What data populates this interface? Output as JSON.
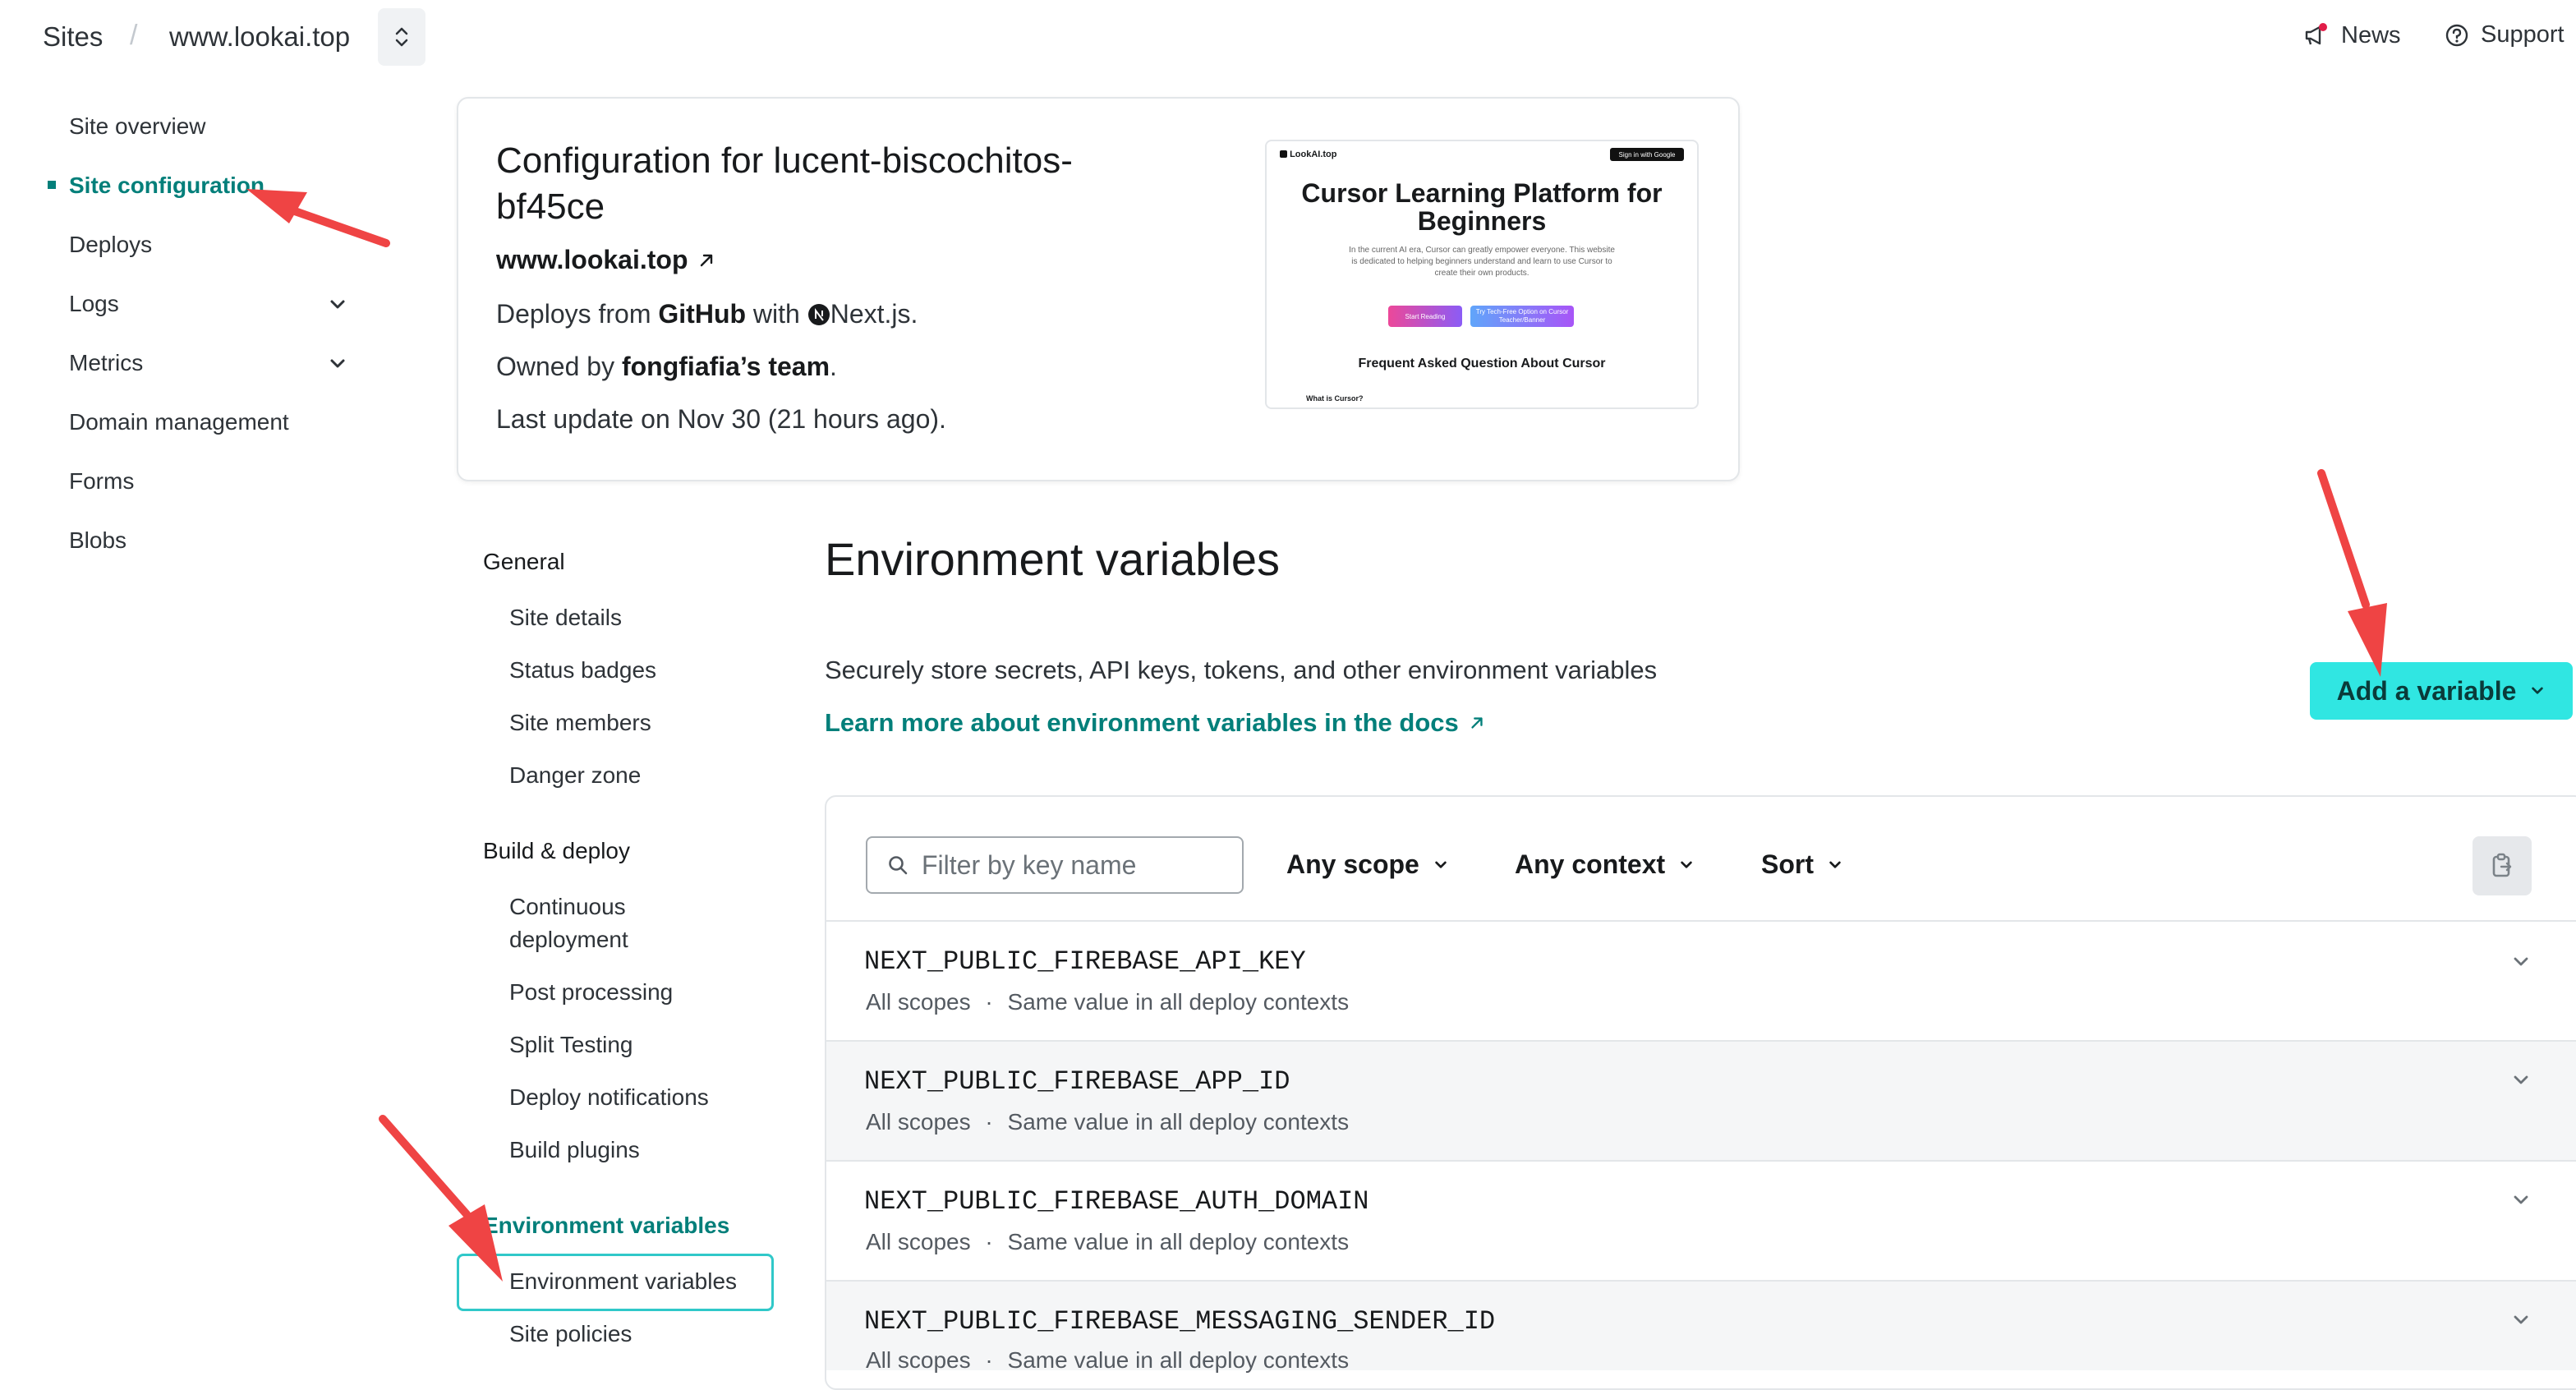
{
  "topbar": {
    "sites_label": "Sites",
    "separator": "/",
    "site_name": "www.lookai.top",
    "news_label": "News",
    "support_label": "Support"
  },
  "sidebar": {
    "items": [
      {
        "label": "Site overview"
      },
      {
        "label": "Site configuration",
        "active": true
      },
      {
        "label": "Deploys"
      },
      {
        "label": "Logs",
        "expandable": true
      },
      {
        "label": "Metrics",
        "expandable": true
      },
      {
        "label": "Domain management"
      },
      {
        "label": "Forms"
      },
      {
        "label": "Blobs"
      }
    ]
  },
  "site_card": {
    "title": "Configuration for lucent-biscochitos-bf45ce",
    "url": "www.lookai.top",
    "deploys_prefix": "Deploys from",
    "deploys_source": "GitHub",
    "deploys_with": "with",
    "framework": "Next.js.",
    "owned_prefix": "Owned by",
    "owner": "fongfiafia’s team",
    "owned_suffix": ".",
    "last_update": "Last update on Nov 30 (21 hours ago).",
    "preview": {
      "logo": "LookAI.top",
      "signin": "Sign in with Google",
      "heading": "Cursor Learning Platform for Beginners",
      "paragraph": "In the current AI era, Cursor can greatly empower everyone. This website is dedicated to helping beginners understand and learn to use Cursor to create their own products.",
      "btn_primary": "Start Reading",
      "btn_secondary": "Try Tech-Free Option on Cursor Teacher/Banner",
      "faq_title": "Frequent Asked Question About Cursor",
      "faq_first": "What is Cursor?"
    }
  },
  "settings_nav": {
    "general": {
      "heading": "General",
      "items": [
        "Site details",
        "Status badges",
        "Site members",
        "Danger zone"
      ]
    },
    "build": {
      "heading": "Build & deploy",
      "items": [
        "Continuous deployment",
        "Post processing",
        "Split Testing",
        "Deploy notifications",
        "Build plugins"
      ]
    },
    "env": {
      "heading": "Environment variables",
      "items": [
        "Environment variables",
        "Site policies"
      ]
    }
  },
  "env": {
    "title": "Environment variables",
    "description": "Securely store secrets, API keys, tokens, and other environment variables",
    "docs_link": "Learn more about environment variables in the docs",
    "add_button": "Add a variable",
    "filter_placeholder": "Filter by key name",
    "scope_dropdown": "Any scope",
    "context_dropdown": "Any context",
    "sort_dropdown": "Sort",
    "meta_separator": "·",
    "variables": [
      {
        "key": "NEXT_PUBLIC_FIREBASE_API_KEY",
        "scope": "All scopes",
        "context": "Same value in all deploy contexts"
      },
      {
        "key": "NEXT_PUBLIC_FIREBASE_APP_ID",
        "scope": "All scopes",
        "context": "Same value in all deploy contexts"
      },
      {
        "key": "NEXT_PUBLIC_FIREBASE_AUTH_DOMAIN",
        "scope": "All scopes",
        "context": "Same value in all deploy contexts"
      },
      {
        "key": "NEXT_PUBLIC_FIREBASE_MESSAGING_SENDER_ID",
        "scope": "All scopes",
        "context": "Same value in all deploy contexts"
      }
    ]
  },
  "colors": {
    "accent": "#037f7a",
    "button": "#30e6e2",
    "annotation_arrow": "#ef4444",
    "focus_ring": "#30c8c9"
  }
}
